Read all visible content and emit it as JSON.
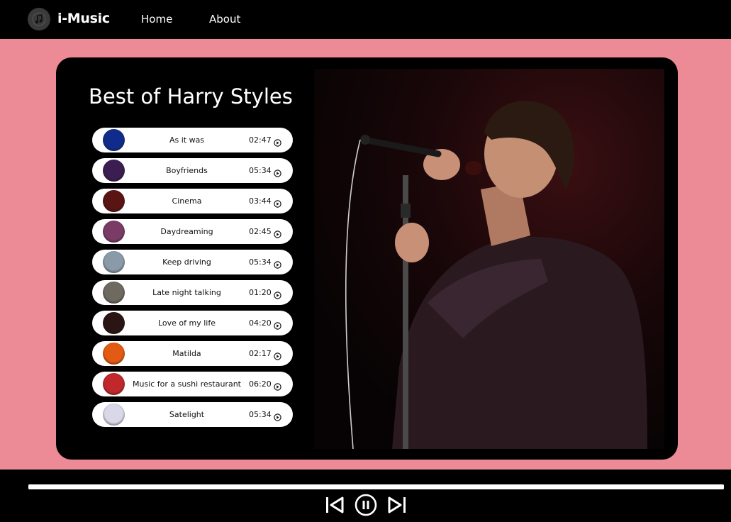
{
  "header": {
    "brand": "i-Music",
    "logo_icon": "music-note-icon",
    "nav": [
      {
        "label": "Home"
      },
      {
        "label": "About"
      }
    ]
  },
  "playlist": {
    "title": "Best of Harry Styles",
    "songs": [
      {
        "name": "As it was",
        "duration": "02:47",
        "thumb_color": "#0f2c8c"
      },
      {
        "name": "Boyfriends",
        "duration": "05:34",
        "thumb_color": "#3b1d52"
      },
      {
        "name": "Cinema",
        "duration": "03:44",
        "thumb_color": "#5a1412"
      },
      {
        "name": "Daydreaming",
        "duration": "02:45",
        "thumb_color": "#7a3c66"
      },
      {
        "name": "Keep driving",
        "duration": "05:34",
        "thumb_color": "#8a9aa8"
      },
      {
        "name": "Late night talking",
        "duration": "01:20",
        "thumb_color": "#6e6a60"
      },
      {
        "name": "Love of my life",
        "duration": "04:20",
        "thumb_color": "#2a1414"
      },
      {
        "name": "Matilda",
        "duration": "02:17",
        "thumb_color": "#e35a12"
      },
      {
        "name": "Music for a sushi restaurant",
        "duration": "06:20",
        "thumb_color": "#c0282b"
      },
      {
        "name": "Satelight",
        "duration": "05:34",
        "thumb_color": "#d8d8e8"
      }
    ]
  },
  "cover_image": {
    "alt": "artist-photo"
  },
  "player": {
    "progress": 1.0,
    "controls": [
      "previous-icon",
      "pause-icon",
      "next-icon"
    ]
  },
  "colors": {
    "page_background": "#ec8a95",
    "card_background": "#000000",
    "nav_background": "#000000"
  }
}
